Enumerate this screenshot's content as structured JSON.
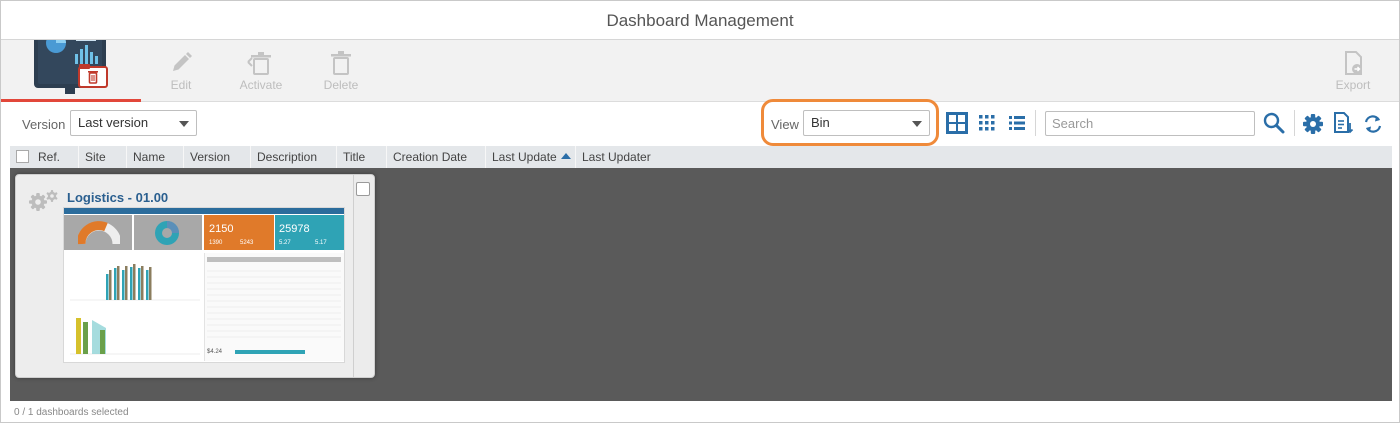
{
  "window": {
    "title": "Dashboard Management"
  },
  "toolbar": {
    "buttons": [
      {
        "label": "Edit",
        "icon": "pencil-icon"
      },
      {
        "label": "Activate",
        "icon": "activate-icon"
      },
      {
        "label": "Delete",
        "icon": "trash-icon"
      },
      {
        "label": "Export",
        "icon": "export-icon"
      }
    ]
  },
  "filters": {
    "version_label": "Version",
    "version_value": "Last version",
    "view_label": "View",
    "view_value": "Bin",
    "search_placeholder": "Search"
  },
  "columns": [
    "Ref.",
    "Site",
    "Name",
    "Version",
    "Description",
    "Title",
    "Creation Date",
    "Last Update",
    "Last Updater"
  ],
  "cards": [
    {
      "title": "Logistics - 01.00",
      "thumbnail": {
        "kpi1_value": "2150",
        "kpi1_sub": "1390",
        "kpi1_sub2": "5243",
        "kpi2_value": "25978",
        "kpi2_sub": "5.27",
        "kpi2_sub2": "5.17",
        "footer_value": "$4.24"
      }
    }
  ],
  "status": {
    "text": "0 / 1 dashboards selected"
  },
  "colors": {
    "accent": "#2a6ea8",
    "highlight": "#ef8a3a",
    "orange": "#e07a2a",
    "teal": "#2fa3b5",
    "brand_red": "#c0392b"
  }
}
